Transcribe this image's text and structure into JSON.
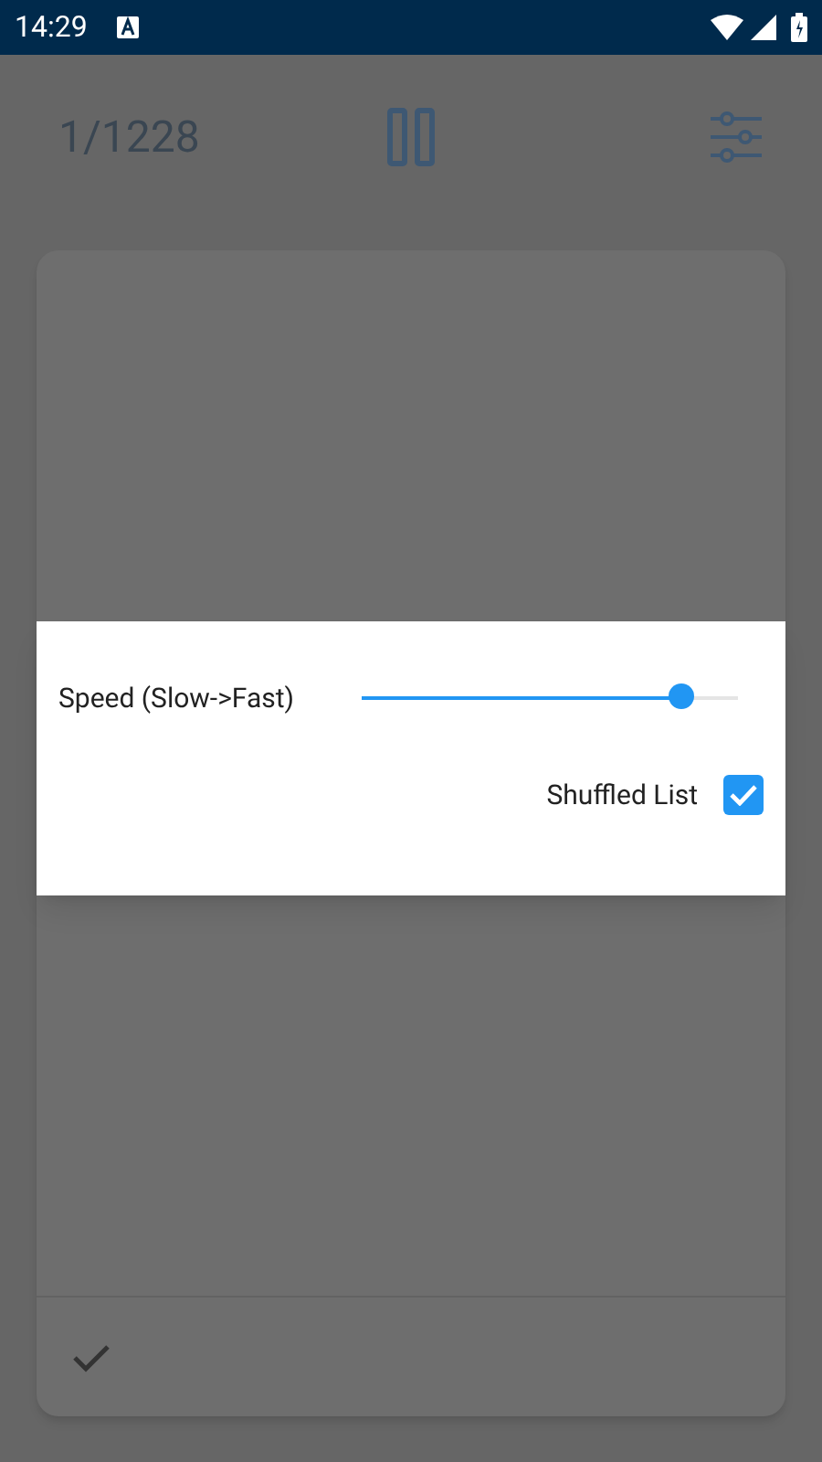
{
  "status_bar": {
    "time": "14:29"
  },
  "toolbar": {
    "counter": "1/1228"
  },
  "dialog": {
    "speed": {
      "label": "Speed (Slow->Fast)",
      "level": 0.85
    },
    "shuffle": {
      "label": "Shuffled List",
      "checked": true
    }
  }
}
